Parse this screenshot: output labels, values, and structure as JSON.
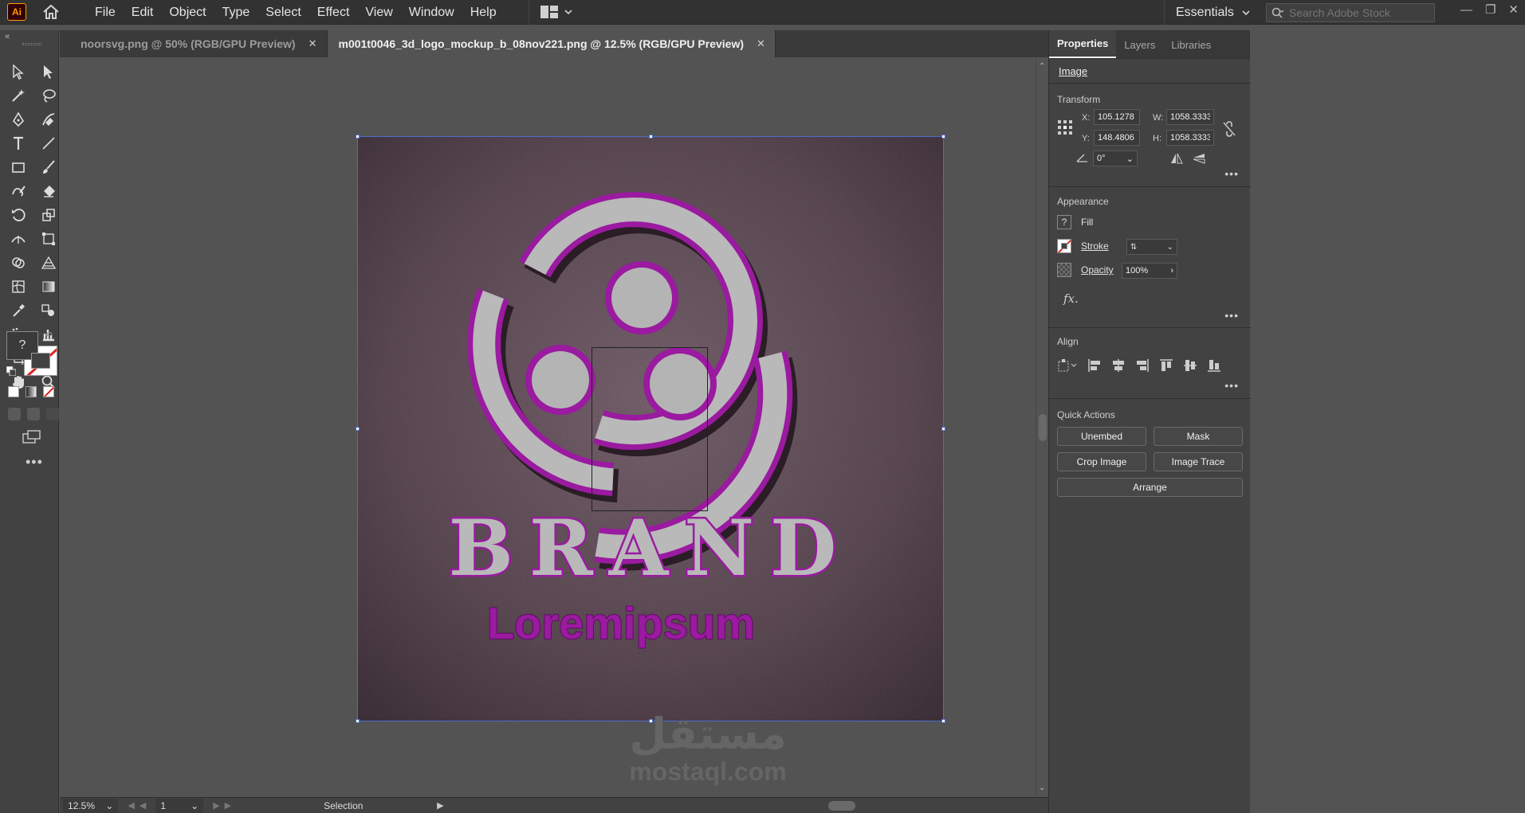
{
  "app": {
    "logo": "Ai"
  },
  "menu": [
    "File",
    "Edit",
    "Object",
    "Type",
    "Select",
    "Effect",
    "View",
    "Window",
    "Help"
  ],
  "workspace": {
    "label": "Essentials"
  },
  "search": {
    "placeholder": "Search Adobe Stock"
  },
  "tabs": [
    {
      "label": "noorsvg.png @ 50% (RGB/GPU Preview)",
      "active": false
    },
    {
      "label": "m001t0046_3d_logo_mockup_b_08nov221.png @ 12.5% (RGB/GPU Preview)",
      "active": true
    }
  ],
  "artwork": {
    "brand": "BRAND",
    "tagline": "Loremipsum",
    "logo_color": "#9a1aa0",
    "background_color": "#4e3a45"
  },
  "watermark": {
    "arabic": "مستقل",
    "latin": "mostaql.com"
  },
  "status": {
    "zoom": "12.5%",
    "page": "1",
    "tool": "Selection"
  },
  "panel": {
    "tabs": [
      "Properties",
      "Layers",
      "Libraries"
    ],
    "object_type": "Image",
    "transform": {
      "title": "Transform",
      "x_label": "X:",
      "x": "105.1278 r",
      "y_label": "Y:",
      "y": "148.4806 r",
      "w_label": "W:",
      "w": "1058.3333",
      "h_label": "H:",
      "h": "1058.3333",
      "angle": "0°"
    },
    "appearance": {
      "title": "Appearance",
      "fill_label": "Fill",
      "fill_icon": "?",
      "stroke_label": "Stroke",
      "opacity_label": "Opacity",
      "opacity": "100%",
      "fx": "fx."
    },
    "align": {
      "title": "Align"
    },
    "quick_actions": {
      "title": "Quick Actions",
      "unembed": "Unembed",
      "mask": "Mask",
      "crop": "Crop Image",
      "trace": "Image Trace",
      "arrange": "Arrange"
    }
  },
  "toolbar": {
    "fill_icon": "?"
  }
}
